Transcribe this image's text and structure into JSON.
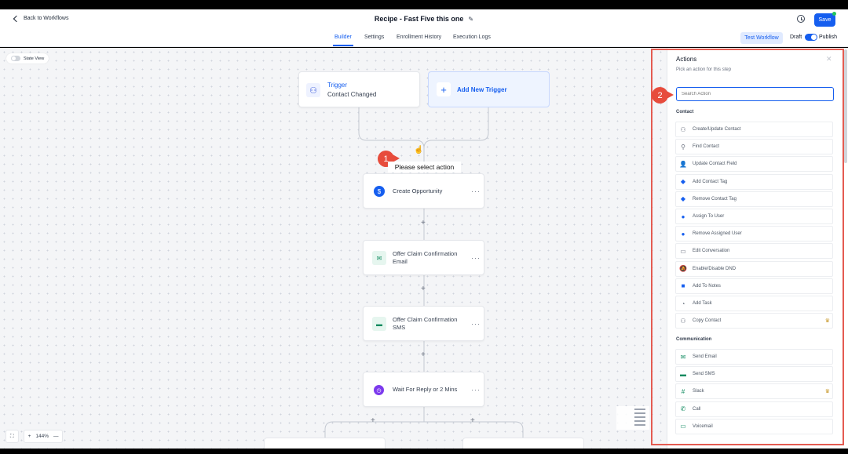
{
  "header": {
    "back_label": "Back to Workflows",
    "title": "Recipe - Fast Five this one",
    "save_label": "Save"
  },
  "tabs": [
    {
      "label": "Builder",
      "active": true
    },
    {
      "label": "Settings",
      "active": false
    },
    {
      "label": "Enrollment History",
      "active": false
    },
    {
      "label": "Execution Logs",
      "active": false
    }
  ],
  "toolbar": {
    "test_label": "Test Workflow",
    "draft_label": "Draft",
    "publish_label": "Publish",
    "published": true
  },
  "canvas": {
    "state_view_label": "State View",
    "trigger": {
      "title": "Trigger",
      "subtitle": "Contact Changed"
    },
    "add_trigger_label": "Add New Trigger",
    "please_select": "Please select action",
    "steps": [
      {
        "label": "Create Opportunity",
        "icon": "dollar-icon",
        "color": "#155eef"
      },
      {
        "label": "Offer Claim Confirmation Email",
        "icon": "mail-icon",
        "color": "#0f8a5f"
      },
      {
        "label": "Offer Claim Confirmation SMS",
        "icon": "sms-icon",
        "color": "#0f8a5f"
      },
      {
        "label": "Wait For Reply or 2 Mins",
        "icon": "clock-icon",
        "color": "#7c3aed"
      }
    ],
    "zoom_level": "144%"
  },
  "annotations": {
    "badge1": "1",
    "badge2": "2",
    "color": "#e45b51"
  },
  "panel": {
    "title": "Actions",
    "subtitle": "Pick an action for this step",
    "search_placeholder": "Search Action",
    "sections": [
      {
        "title": "Contact",
        "items": [
          {
            "label": "Create/Update Contact",
            "icon": "person-plus-icon",
            "glyph": "⚇",
            "color": "#6b7280"
          },
          {
            "label": "Find Contact",
            "icon": "person-search-icon",
            "glyph": "⚲",
            "color": "#6b7280"
          },
          {
            "label": "Update Contact Field",
            "icon": "person-edit-icon",
            "glyph": "👤",
            "color": "#155eef"
          },
          {
            "label": "Add Contact Tag",
            "icon": "tag-icon",
            "glyph": "◆",
            "color": "#155eef"
          },
          {
            "label": "Remove Contact Tag",
            "icon": "tag-remove-icon",
            "glyph": "◆",
            "color": "#155eef"
          },
          {
            "label": "Assign To User",
            "icon": "user-icon",
            "glyph": "●",
            "color": "#155eef"
          },
          {
            "label": "Remove Assigned User",
            "icon": "user-remove-icon",
            "glyph": "●",
            "color": "#155eef"
          },
          {
            "label": "Edit Conversation",
            "icon": "conversation-icon",
            "glyph": "▭",
            "color": "#6b7280"
          },
          {
            "label": "Enable/Disable DND",
            "icon": "bell-off-icon",
            "glyph": "🔕",
            "color": "#155eef"
          },
          {
            "label": "Add To Notes",
            "icon": "note-icon",
            "glyph": "■",
            "color": "#155eef"
          },
          {
            "label": "Add Task",
            "icon": "task-icon",
            "glyph": "◔",
            "color": "#6b7280"
          },
          {
            "label": "Copy Contact",
            "icon": "copy-contact-icon",
            "glyph": "⚇",
            "color": "#6b7280",
            "premium": true
          }
        ]
      },
      {
        "title": "Communication",
        "items": [
          {
            "label": "Send Email",
            "icon": "email-icon",
            "glyph": "✉",
            "color": "#0f8a5f"
          },
          {
            "label": "Send SMS",
            "icon": "sms-icon",
            "glyph": "▬",
            "color": "#0f8a5f"
          },
          {
            "label": "Slack",
            "icon": "slack-icon",
            "glyph": "#",
            "color": "#0f8a5f",
            "premium": true
          },
          {
            "label": "Call",
            "icon": "phone-icon",
            "glyph": "✆",
            "color": "#0f8a5f"
          },
          {
            "label": "Voicemail",
            "icon": "voicemail-icon",
            "glyph": "▭",
            "color": "#0f8a5f"
          }
        ]
      }
    ]
  }
}
